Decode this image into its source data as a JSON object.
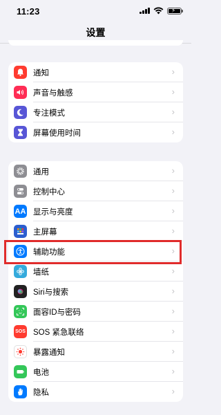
{
  "status": {
    "time": "11:23"
  },
  "nav": {
    "title": "设置"
  },
  "group1": [
    {
      "label": "通知",
      "icon": "bell-icon",
      "color": "#ff3b30"
    },
    {
      "label": "声音与触感",
      "icon": "speaker-icon",
      "color": "#ff2d55"
    },
    {
      "label": "专注模式",
      "icon": "moon-icon",
      "color": "#5856d6"
    },
    {
      "label": "屏幕使用时间",
      "icon": "hourglass-icon",
      "color": "#5856d6"
    }
  ],
  "group2": [
    {
      "label": "通用",
      "icon": "gear-icon",
      "color": "#8e8e93"
    },
    {
      "label": "控制中心",
      "icon": "toggles-icon",
      "color": "#8e8e93"
    },
    {
      "label": "显示与亮度",
      "icon": "text-size-icon",
      "color": "#007aff",
      "glyph": "AA"
    },
    {
      "label": "主屏幕",
      "icon": "home-grid-icon",
      "color": "#2c5ecf"
    },
    {
      "label": "辅助功能",
      "icon": "accessibility-icon",
      "color": "#007aff"
    },
    {
      "label": "墙纸",
      "icon": "flower-icon",
      "color": "#34aadc"
    },
    {
      "label": "Siri与搜索",
      "icon": "siri-icon",
      "color": "#222222"
    },
    {
      "label": "面容ID与密码",
      "icon": "face-id-icon",
      "color": "#34c759"
    },
    {
      "label": "SOS 紧急联络",
      "icon": "sos-icon",
      "color": "#ff3b30",
      "glyph": "SOS"
    },
    {
      "label": "暴露通知",
      "icon": "exposure-icon",
      "color": "#ffffff"
    },
    {
      "label": "电池",
      "icon": "battery-icon",
      "color": "#34c759"
    },
    {
      "label": "隐私",
      "icon": "hand-icon",
      "color": "#007aff"
    }
  ],
  "chevron": "›"
}
